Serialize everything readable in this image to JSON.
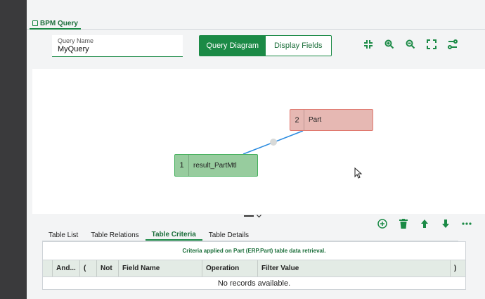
{
  "tab": {
    "title": "BPM Query"
  },
  "query": {
    "label": "Query Name",
    "value": "MyQuery"
  },
  "view_toggle": {
    "diagram_label": "Query Diagram",
    "fields_label": "Display Fields"
  },
  "diagram": {
    "nodes": [
      {
        "index": "2",
        "name": "Part"
      },
      {
        "index": "1",
        "name": "result_PartMtl"
      }
    ],
    "link_color": "#2a8be0"
  },
  "lower_tabs": [
    "Table List",
    "Table Relations",
    "Table Criteria",
    "Table Details"
  ],
  "criteria": {
    "message": "Criteria applied on Part (ERP.Part) table data retrieval.",
    "columns": [
      "And...",
      "(",
      "Not",
      "Field Name",
      "Operation",
      "Filter Value",
      ")"
    ],
    "empty_text": "No records available."
  },
  "colors": {
    "accent": "#1b8a46",
    "part_node": "#e6b8b3",
    "result_node": "#97cc9e"
  }
}
